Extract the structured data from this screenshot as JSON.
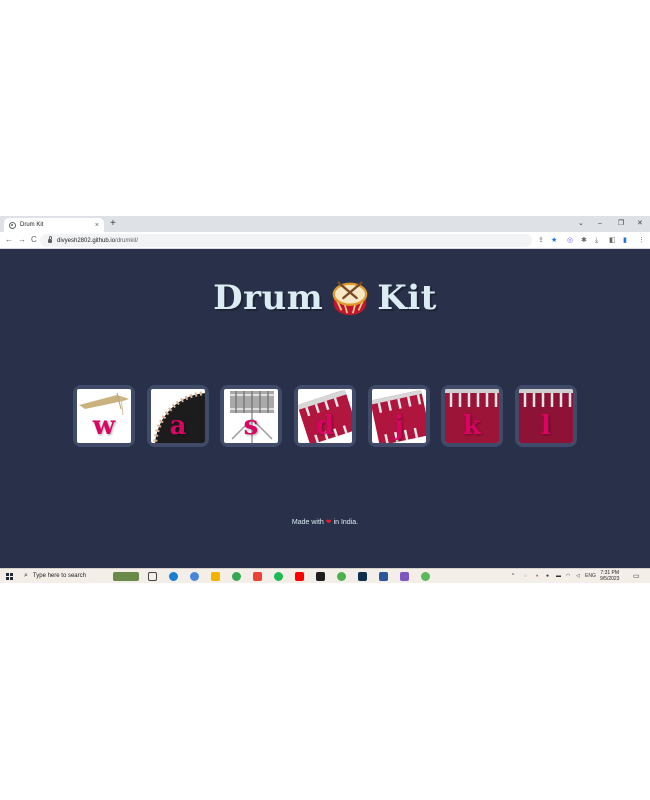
{
  "browser": {
    "tab_title": "Drum Kit",
    "tab_close": "×",
    "new_tab": "+",
    "url_host": "divyesh2802.github.io",
    "url_path": "/drumkit/",
    "window_controls": [
      "⌄",
      "–",
      "❐",
      "✕"
    ],
    "nav": {
      "back": "←",
      "forward": "→",
      "reload": "C"
    }
  },
  "page": {
    "title_left": "Drum",
    "title_right": "Kit",
    "drums": [
      {
        "key": "w",
        "icon": "crash-cymbal"
      },
      {
        "key": "a",
        "icon": "kick-drum"
      },
      {
        "key": "s",
        "icon": "snare-drum"
      },
      {
        "key": "d",
        "icon": "tom-drum-1"
      },
      {
        "key": "j",
        "icon": "tom-drum-2"
      },
      {
        "key": "k",
        "icon": "tom-drum-3"
      },
      {
        "key": "l",
        "icon": "tom-drum-4"
      }
    ],
    "footer_before": "Made with",
    "footer_heart": "❤",
    "footer_after": "in India."
  },
  "taskbar": {
    "search_placeholder": "Type here to search",
    "language": "ENG",
    "time": "7:31 PM",
    "date": "9/5/2023"
  },
  "colors": {
    "page_bg": "#283149",
    "drum_frame": "#404b69",
    "letter": "#da0463",
    "heading": "#dbedf3"
  }
}
